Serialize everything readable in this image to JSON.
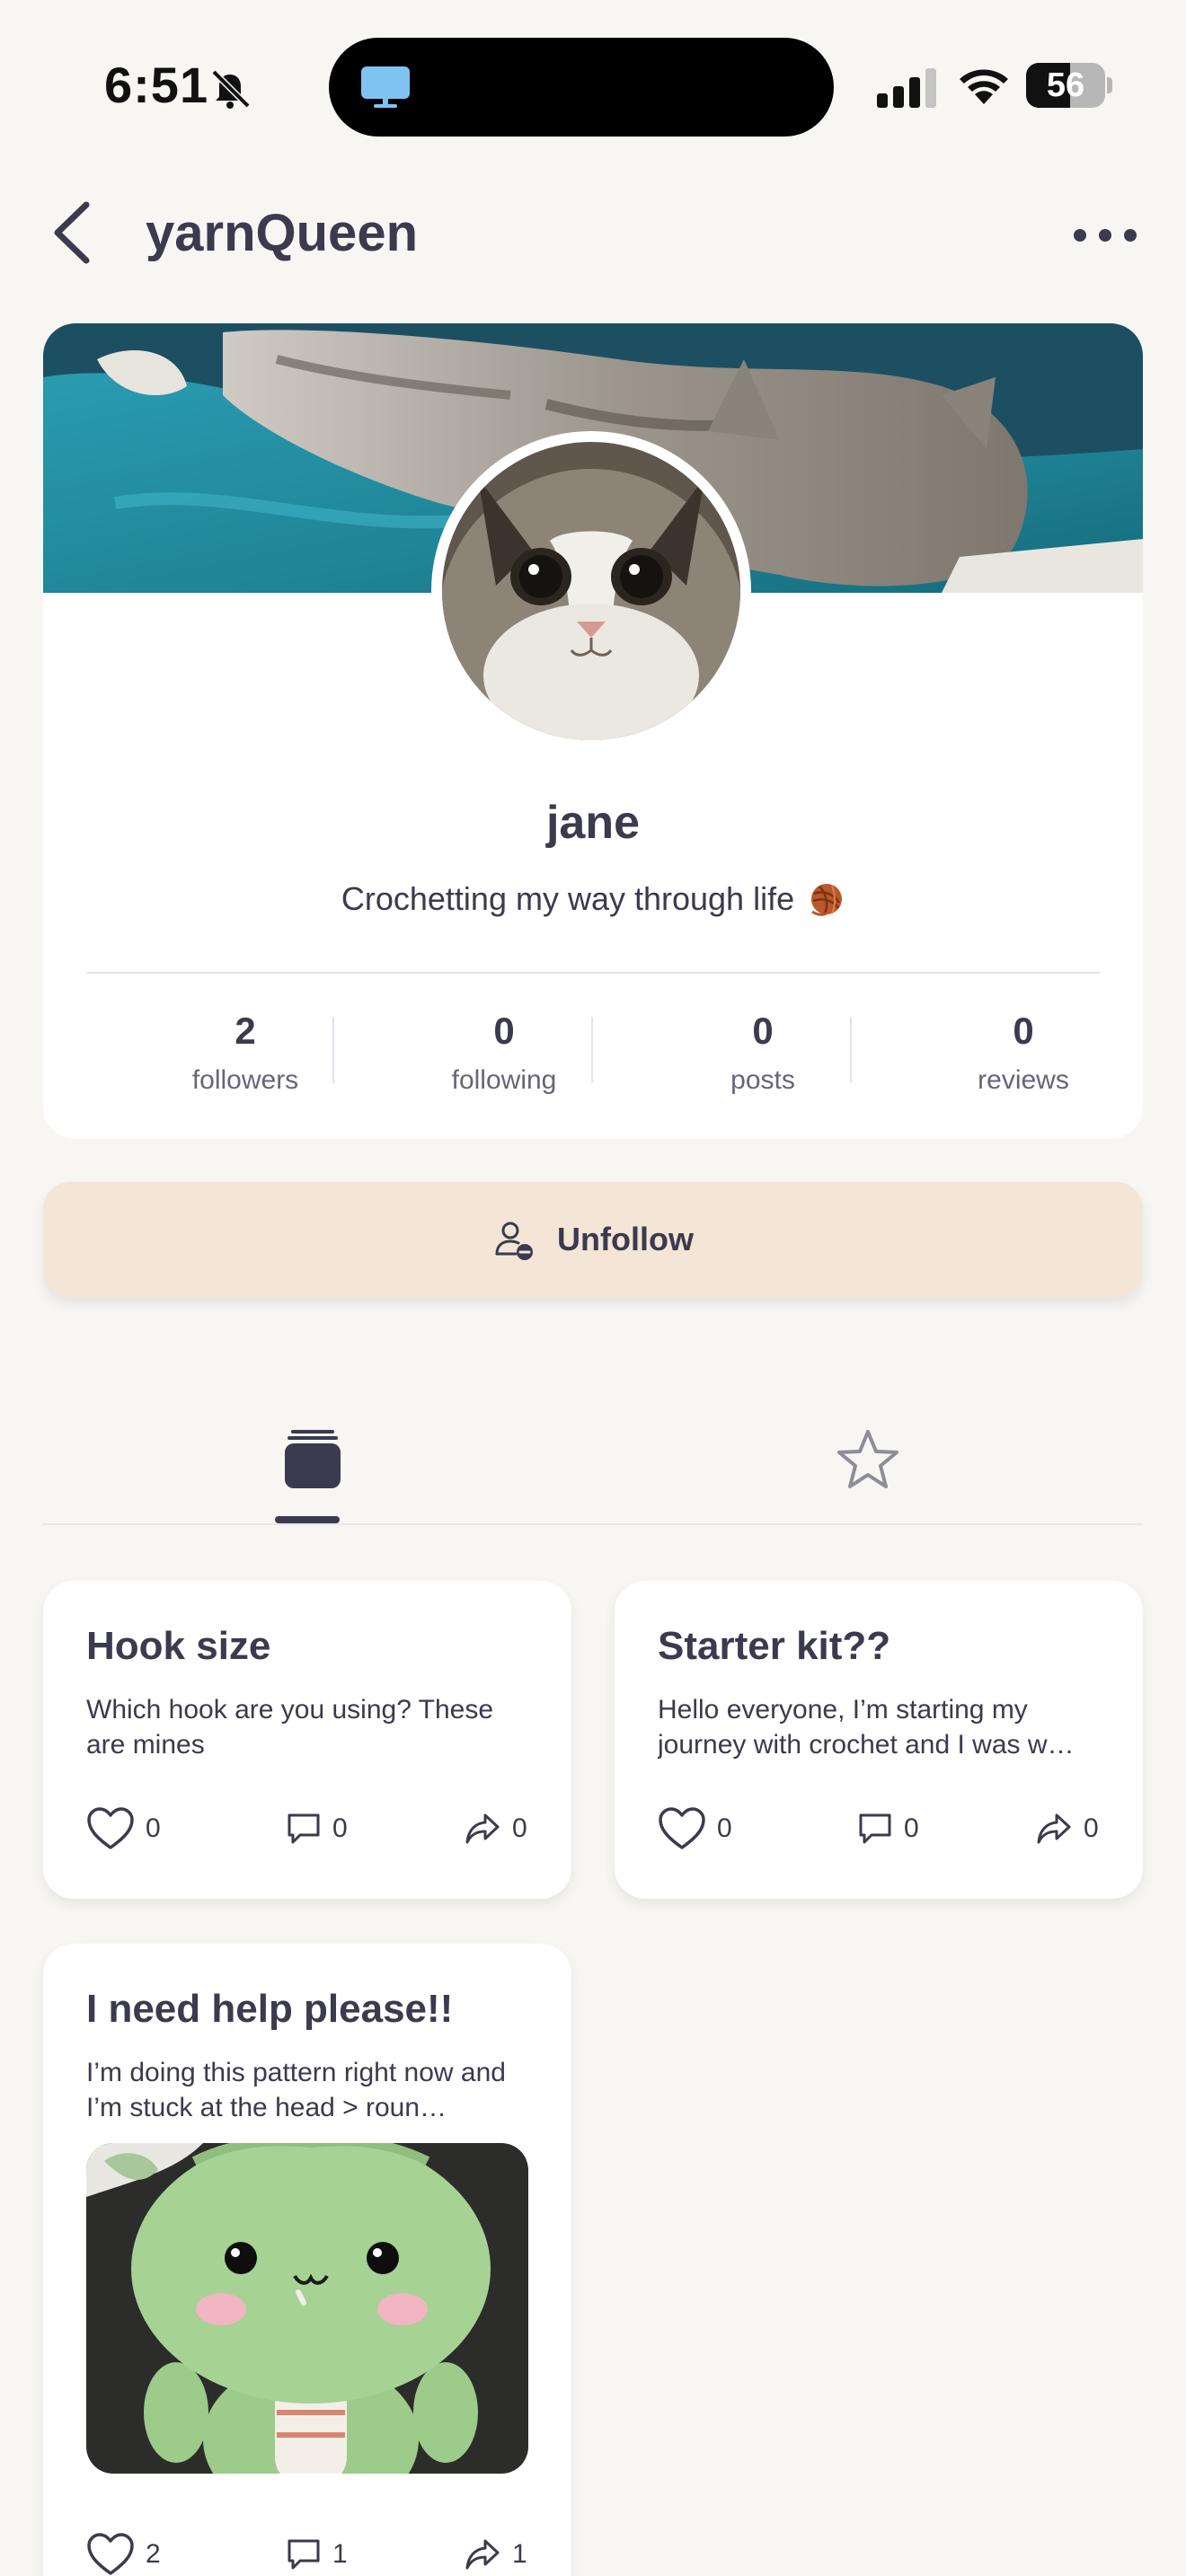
{
  "status_bar": {
    "time": "6:51",
    "battery": "56",
    "battery_level": 0.56
  },
  "header": {
    "title": "yarnQueen"
  },
  "profile": {
    "display_name": "jane",
    "bio": "Crochetting my way through life",
    "bio_emoji": "yarn-ball-icon",
    "stats": [
      {
        "count": "2",
        "label": "followers"
      },
      {
        "count": "0",
        "label": "following"
      },
      {
        "count": "0",
        "label": "posts"
      },
      {
        "count": "0",
        "label": "reviews"
      }
    ]
  },
  "actions": {
    "unfollow_label": "Unfollow"
  },
  "tabs": [
    {
      "icon": "posts-stack-icon",
      "active": true
    },
    {
      "icon": "star-icon",
      "active": false
    }
  ],
  "posts": [
    {
      "title": "Hook size",
      "excerpt": "Which hook are you using? These are mines",
      "likes": "0",
      "comments": "0",
      "shares": "0"
    },
    {
      "title": "Starter kit??",
      "excerpt": "Hello everyone, I’m starting my journey with crochet and I was w…",
      "likes": "0",
      "comments": "0",
      "shares": "0"
    },
    {
      "title": "I need help please!!",
      "excerpt": "I’m doing this pattern right now and I’m stuck at the head > roun…",
      "likes": "2",
      "comments": "1",
      "shares": "1"
    }
  ],
  "colors": {
    "background": "#f7f6f3",
    "text": "#3b3a4e",
    "unfollow_button": "#f3e6d6",
    "card": "#ffffff"
  }
}
